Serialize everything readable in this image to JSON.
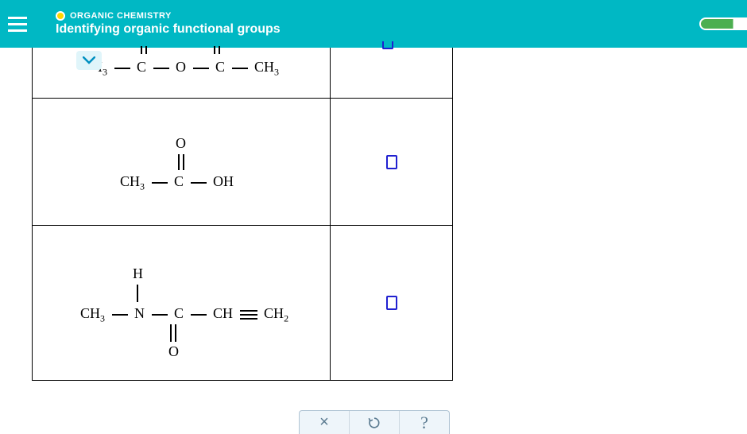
{
  "header": {
    "category": "ORGANIC CHEMISTRY",
    "title": "Identifying organic functional groups"
  },
  "rows": {
    "r1": {
      "dbond_top": "||",
      "frag_i3": "I",
      "frag_i3_sub": "3",
      "c1": "C",
      "o_mid": "O",
      "c2": "C",
      "ch3": "CH",
      "ch3_sub": "3"
    },
    "r2": {
      "o_top": "O",
      "ch3": "CH",
      "ch3_sub": "3",
      "c": "C",
      "oh": "OH"
    },
    "r3": {
      "h_top": "H",
      "ch3": "CH",
      "ch3_sub": "3",
      "n": "N",
      "c": "C",
      "ch": "CH",
      "ch2": "CH",
      "ch2_sub": "2",
      "o_bottom": "O"
    }
  },
  "actions": {
    "close_label": "×",
    "help_label": "?"
  }
}
